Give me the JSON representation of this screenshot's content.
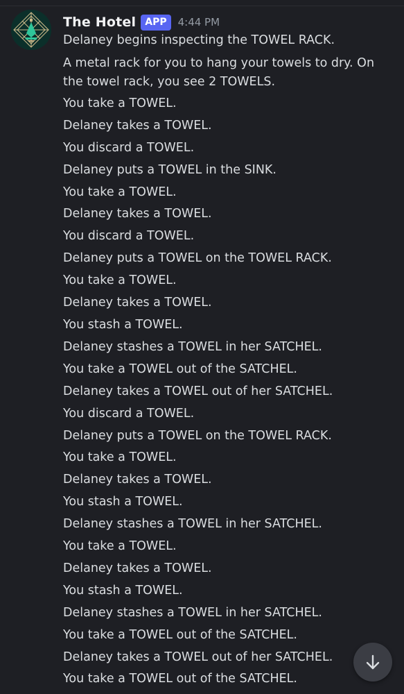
{
  "message": {
    "username": "The Hotel",
    "badge": "APP",
    "timestamp": "4:44 PM",
    "lines": [
      "Delaney begins inspecting the TOWEL RACK.",
      "A metal rack for you to hang your towels to dry. On the towel rack, you see 2 TOWELS.",
      "You take a TOWEL.",
      "Delaney takes a TOWEL.",
      "You discard a TOWEL.",
      "Delaney puts a TOWEL in the SINK.",
      "You take a TOWEL.",
      "Delaney takes a TOWEL.",
      "You discard a TOWEL.",
      "Delaney puts a TOWEL on the TOWEL RACK.",
      "You take a TOWEL.",
      "Delaney takes a TOWEL.",
      "You stash a TOWEL.",
      "Delaney stashes a TOWEL in her SATCHEL.",
      "You take a TOWEL out of the SATCHEL.",
      "Delaney takes a TOWEL out of her SATCHEL.",
      "You discard a TOWEL.",
      "Delaney puts a TOWEL on the TOWEL RACK.",
      "You take a TOWEL.",
      "Delaney takes a TOWEL.",
      "You stash a TOWEL.",
      "Delaney stashes a TOWEL in her SATCHEL.",
      "You take a TOWEL.",
      "Delaney takes a TOWEL.",
      "You stash a TOWEL.",
      "Delaney stashes a TOWEL in her SATCHEL.",
      "You take a TOWEL out of the SATCHEL.",
      "Delaney takes a TOWEL out of her SATCHEL.",
      "You take a TOWEL out of the SATCHEL."
    ]
  },
  "icons": {
    "avatar": "hotel-art-deco-logo",
    "scroll": "arrow-down-icon"
  },
  "colors": {
    "background": "#1e1f24",
    "badge": "#5865f2",
    "text": "#dbdee1",
    "muted": "#949ba4"
  }
}
